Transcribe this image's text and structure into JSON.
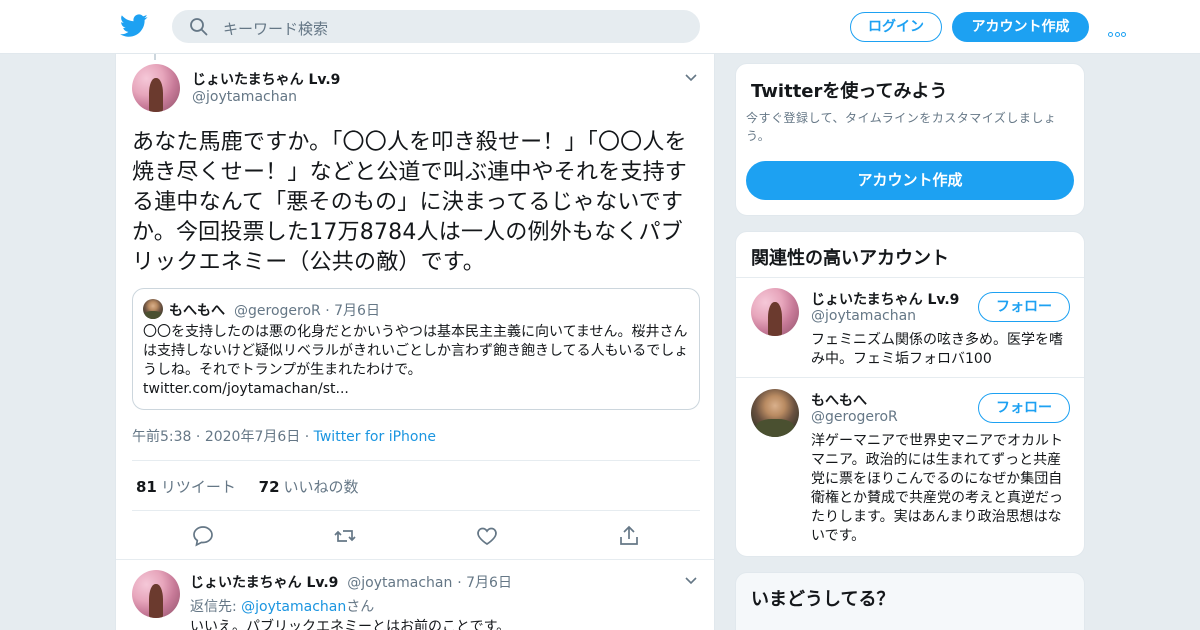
{
  "header": {
    "search_placeholder": "キーワード検索",
    "login_label": "ログイン",
    "signup_label": "アカウント作成"
  },
  "tweet": {
    "name": "じょいたまちゃん Lv.9",
    "handle": "@joytamachan",
    "text": "あなた馬鹿ですか。「〇〇人を叩き殺せー！」「〇〇人を焼き尽くせー！」などと公道で叫ぶ連中やそれを支持する連中なんて「悪そのもの」に決まってるじゃないですか。今回投票した17万8784人は一人の例外もなくパブリックエネミー（公共の敵）です。",
    "quote": {
      "name": "もへもへ",
      "handle": "@gerogeroR",
      "date": "7月6日",
      "text": "〇〇を支持したのは悪の化身だとかいうやつは基本民主主義に向いてません。桜井さんは支持しないけど疑似リベラルがきれいごとしか言わず飽き飽きしてる人もいるでしょうしね。それでトランプが生まれたわけで。",
      "link": "twitter.com/joytamachan/st..."
    },
    "time": "午前5:38",
    "date": "2020年7月6日",
    "source": "Twitter for iPhone",
    "retweets": "81",
    "retweets_label": "リツイート",
    "likes": "72",
    "likes_label": "いいねの数"
  },
  "reply": {
    "name": "じょいたまちゃん Lv.9",
    "handle": "@joytamachan",
    "date": "7月6日",
    "reply_to_prefix": "返信先:",
    "reply_to_handle": "@joytamachan",
    "reply_to_suffix": "さん",
    "text": "いいえ。パブリックエネミーとはお前のことです。"
  },
  "sidebar": {
    "try_title": "Twitterを使ってみよう",
    "try_sub": "今すぐ登録して、タイムラインをカスタマイズしましょう。",
    "try_button": "アカウント作成",
    "related_title": "関連性の高いアカウント",
    "follow_label": "フォロー",
    "accounts": [
      {
        "name": "じょいたまちゃん Lv.9",
        "handle": "@joytamachan",
        "bio": "フェミニズム関係の呟き多め。医学を嗜み中。フェミ垢フォロバ100"
      },
      {
        "name": "もへもへ",
        "handle": "@gerogeroR",
        "bio": "洋ゲーマニアで世界史マニアでオカルトマニア。政治的には生まれてずっと共産党に票をほりこんでるのになぜか集団自衛権とか賛成で共産党の考えと真逆だったりします。実はあんまり政治思想はないです。"
      }
    ],
    "whats_title": "いまどうしてる？"
  },
  "colors": {
    "accent": "#1da1f2",
    "link": "#1b95e0",
    "muted": "#657786",
    "bg": "#e6ecf0"
  }
}
